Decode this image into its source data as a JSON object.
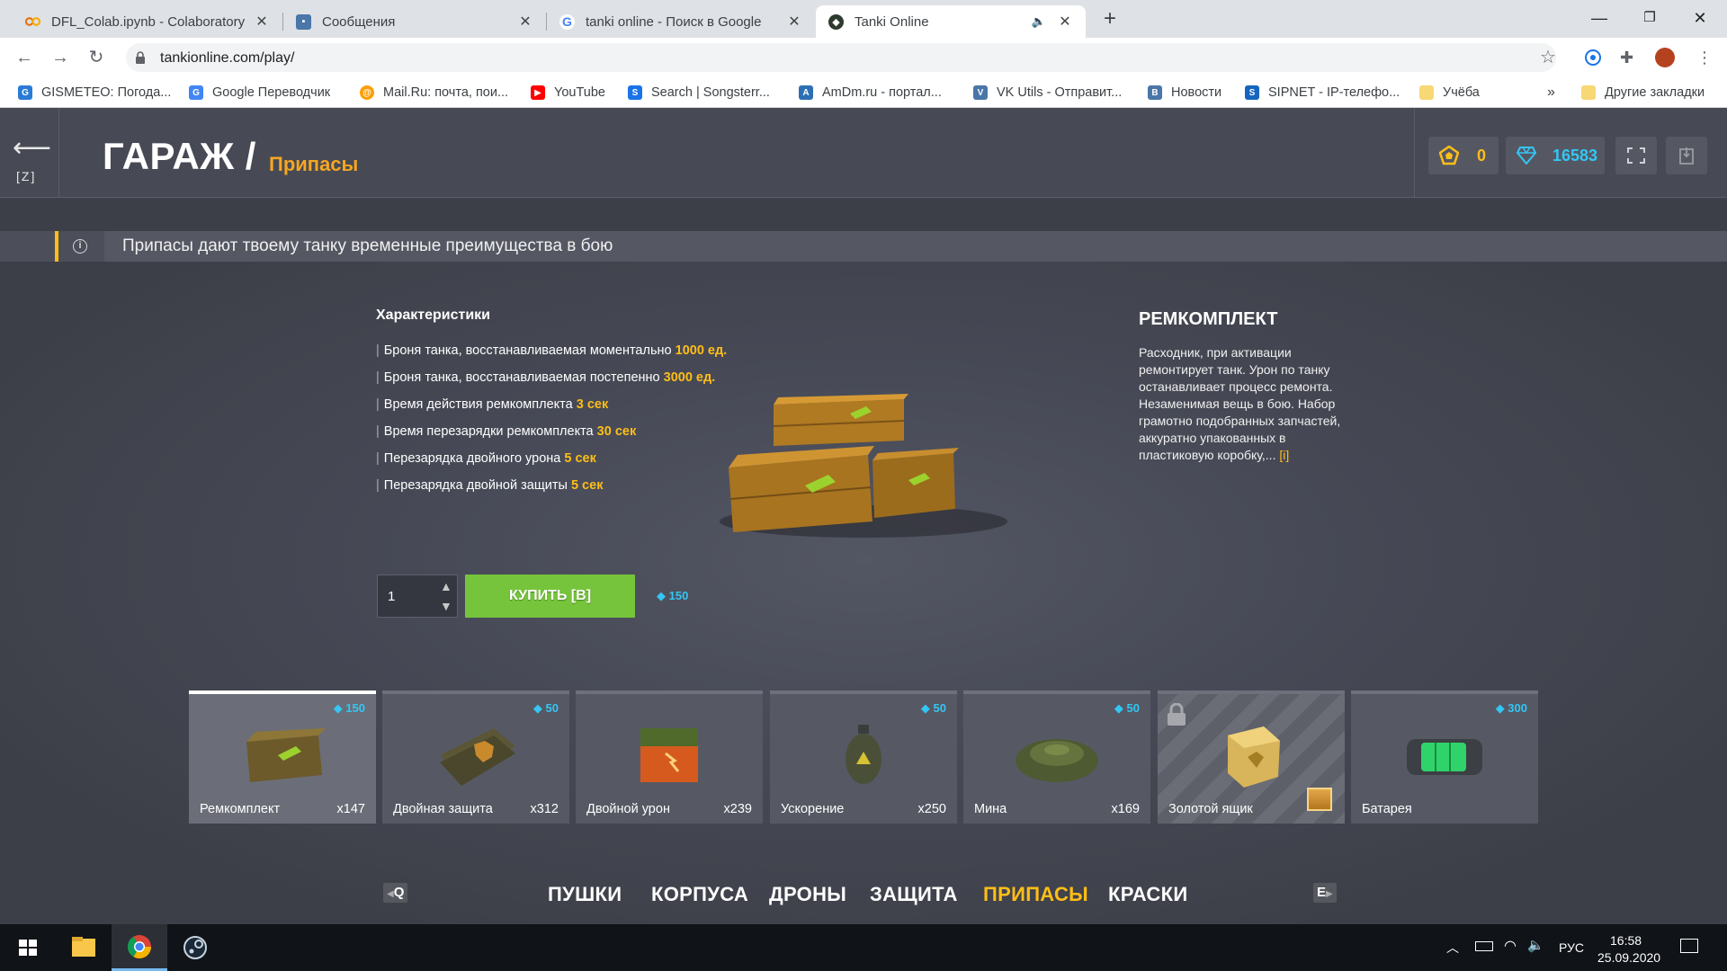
{
  "browser": {
    "tabs": [
      {
        "title": "DFL_Colab.ipynb - Colaboratory",
        "favicon": "colab-icon"
      },
      {
        "title": "Сообщения",
        "favicon": "messages-icon"
      },
      {
        "title": "tanki online - Поиск в Google",
        "favicon": "google-icon"
      },
      {
        "title": "Tanki Online",
        "favicon": "tanki-icon",
        "active": true
      }
    ],
    "url": "tankionline.com/play/",
    "bookmarks": [
      "GISMETEO: Погода...",
      "Google Переводчик",
      "Mail.Ru: почта, пои...",
      "YouTube",
      "Search | Songsterr...",
      "AmDm.ru - портал...",
      "VK Utils - Отправит...",
      "Новости",
      "SIPNET - IP-телефо...",
      "Учёба"
    ],
    "bookmarks_overflow": "»",
    "other_bookmarks": "Другие закладки"
  },
  "game": {
    "back_key": "[Z]",
    "title": "ГАРАЖ /",
    "subtitle": "Припасы",
    "stars": "0",
    "crystals": "16583",
    "info_text": "Припасы дают твоему танку временные преимущества в бою",
    "characteristics_title": "Характеристики",
    "stats": [
      {
        "label": "Броня танка, восстанавливаемая моментально",
        "value": "1000 ед."
      },
      {
        "label": "Броня танка, восстанавливаемая постепенно",
        "value": "3000 ед."
      },
      {
        "label": "Время действия ремкомплекта",
        "value": "3 сек"
      },
      {
        "label": "Время перезарядки ремкомплекта",
        "value": "30 сек"
      },
      {
        "label": "Перезарядка двойного урона",
        "value": "5 сек"
      },
      {
        "label": "Перезарядка двойной защиты",
        "value": "5 сек"
      }
    ],
    "item_title": "РЕМКОМПЛЕКТ",
    "item_description": "Расходник, при активации ремонтирует танк. Урон по танку останавливает процесс ремонта. Незаменимая вещь в бою. Набор грамотно подобранных запчастей, аккуратно упакованных в пластиковую коробку,...",
    "item_more": "[i]",
    "quantity": "1",
    "buy_label": "КУПИТЬ [B]",
    "buy_price": "150",
    "items": [
      {
        "name": "Ремкомплект",
        "count": "x147",
        "price": "150",
        "selected": true
      },
      {
        "name": "Двойная защита",
        "count": "x312",
        "price": "50"
      },
      {
        "name": "Двойной урон",
        "count": "x239",
        "price": ""
      },
      {
        "name": "Ускорение",
        "count": "x250",
        "price": "50"
      },
      {
        "name": "Мина",
        "count": "x169",
        "price": "50"
      },
      {
        "name": "Золотой ящик",
        "count": "",
        "price": "",
        "locked": true
      },
      {
        "name": "Батарея",
        "count": "",
        "price": "300"
      }
    ],
    "categories": [
      "ПУШКИ",
      "КОРПУСА",
      "ДРОНЫ",
      "ЗАЩИТА",
      "ПРИПАСЫ",
      "КРАСКИ"
    ],
    "active_category": "ПРИПАСЫ",
    "prev_key": "Q",
    "next_key": "E"
  },
  "taskbar": {
    "lang": "РУС",
    "time": "16:58",
    "date": "25.09.2020"
  },
  "colors": {
    "accent_gold": "#ffbe17",
    "crystal_blue": "#34c6f4",
    "buy_green": "#76c43b"
  }
}
